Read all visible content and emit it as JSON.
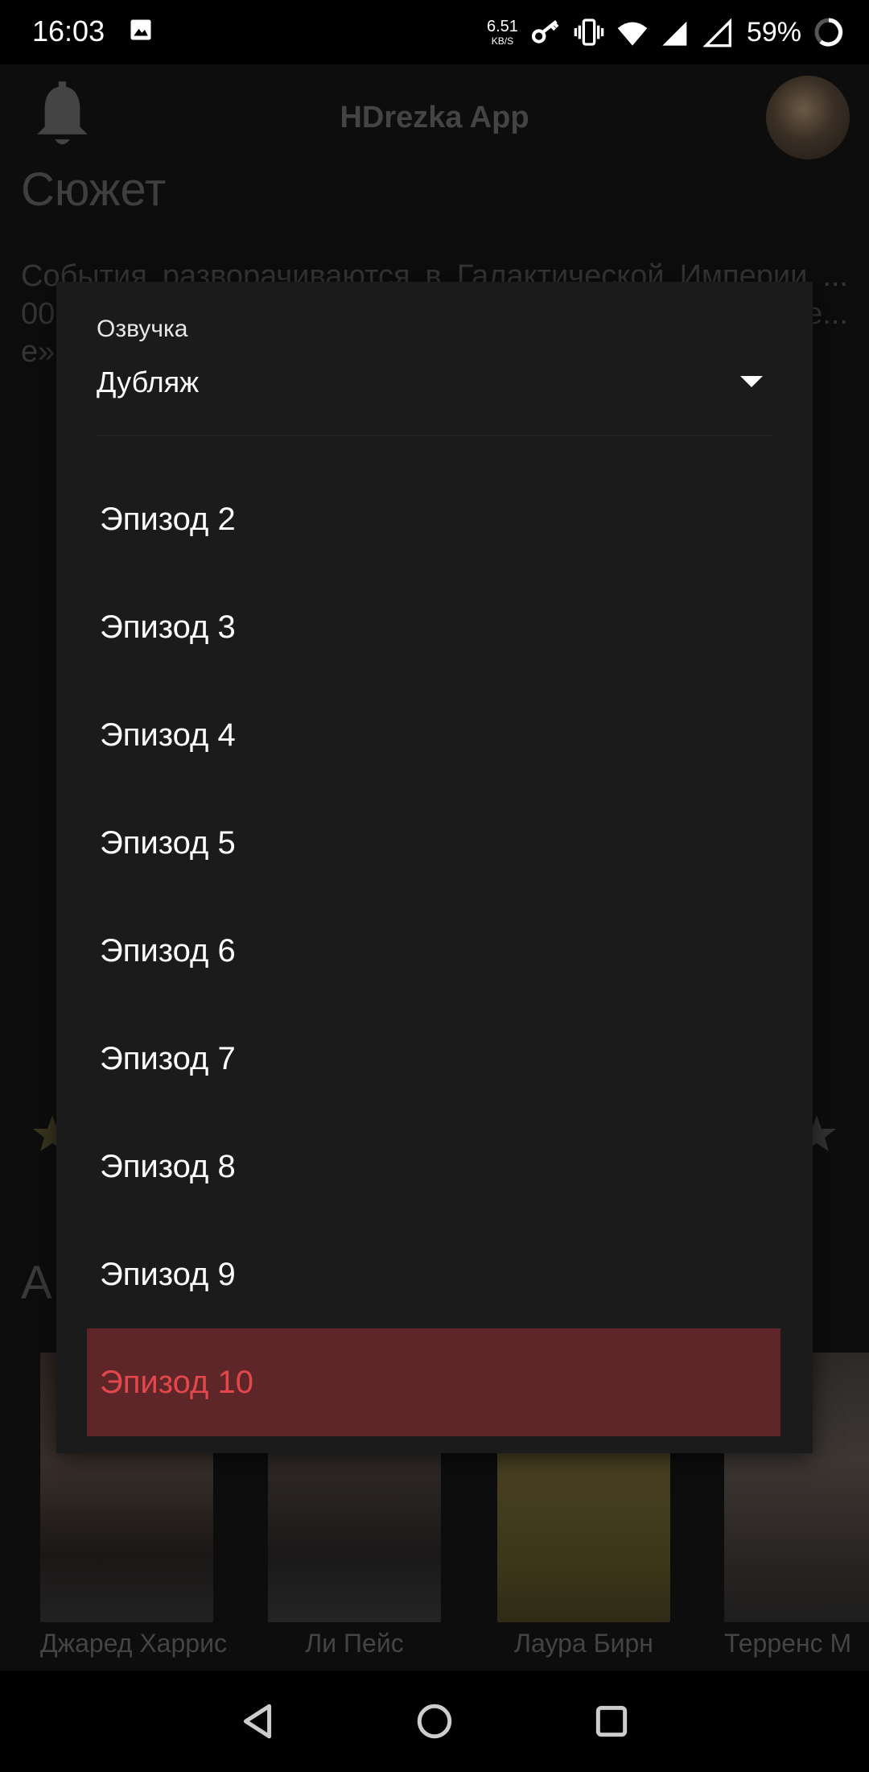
{
  "status_bar": {
    "time": "16:03",
    "net_speed": "6.51",
    "net_speed_unit": "KB/S",
    "battery": "59%",
    "icons": [
      "gallery-icon",
      "key-icon",
      "vibrate-icon",
      "wifi-icon",
      "signal-x-icon",
      "signal-r-icon",
      "battery-ring-icon"
    ]
  },
  "app_bar": {
    "title": "HDrezka App",
    "icons": [
      "bell-icon",
      "avatar"
    ]
  },
  "background": {
    "section_title": "Сюжет",
    "plot_text": "События разворачиваются в Галактической Империи ... 00 ле... на I. ... ку пс... ую гис... его на... ти пр... ете Те... е», за... ех по... чи му... к ма...",
    "actors_heading": "А",
    "actors": [
      {
        "name": "Джаред Харрис"
      },
      {
        "name": "Ли Пейс"
      },
      {
        "name": "Лаура Бирн"
      },
      {
        "name": "Терренс М"
      }
    ]
  },
  "dialog": {
    "voice_label": "Озвучка",
    "voice_value": "Дубляж",
    "episodes": [
      {
        "label": "Эпизод 2",
        "selected": false
      },
      {
        "label": "Эпизод 3",
        "selected": false
      },
      {
        "label": "Эпизод 4",
        "selected": false
      },
      {
        "label": "Эпизод 5",
        "selected": false
      },
      {
        "label": "Эпизод 6",
        "selected": false
      },
      {
        "label": "Эпизод 7",
        "selected": false
      },
      {
        "label": "Эпизод 8",
        "selected": false
      },
      {
        "label": "Эпизод 9",
        "selected": false
      },
      {
        "label": "Эпизод 10",
        "selected": true
      }
    ],
    "accent_color": "#e2474b",
    "selected_bg": "#5e2629"
  },
  "nav_bar": {
    "icons": [
      "back-icon",
      "home-icon",
      "recents-icon"
    ]
  }
}
